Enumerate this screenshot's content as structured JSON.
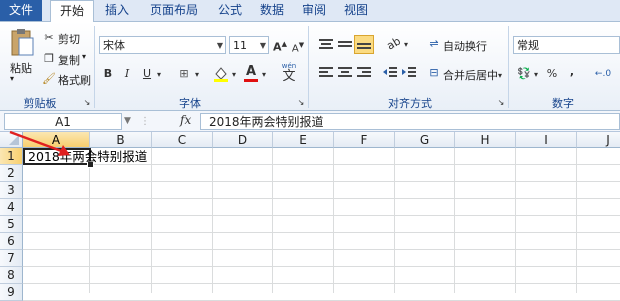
{
  "tabs": [
    {
      "label": "文件"
    },
    {
      "label": "开始"
    },
    {
      "label": "插入"
    },
    {
      "label": "页面布局"
    },
    {
      "label": "公式"
    },
    {
      "label": "数据"
    },
    {
      "label": "审阅"
    },
    {
      "label": "视图"
    }
  ],
  "clipboard": {
    "paste": "粘贴",
    "cut": "剪切",
    "copy": "复制",
    "format_painter": "格式刷",
    "group": "剪贴板"
  },
  "font": {
    "name": "宋体",
    "size": "11",
    "bold": "B",
    "italic": "I",
    "underline": "U",
    "font_color_glyph": "A",
    "phonetic_glyph": "wén",
    "group": "字体"
  },
  "alignment": {
    "wrap": "自动换行",
    "merge": "合并后居中",
    "group": "对齐方式"
  },
  "number": {
    "format": "常规",
    "percent": "%",
    "comma": ",",
    "group": "数字"
  },
  "formula_bar": {
    "name_box": "A1",
    "fx": "fx",
    "content": "2018年两会特别报道"
  },
  "columns": [
    "A",
    "B",
    "C",
    "D",
    "E",
    "F",
    "G",
    "H",
    "I",
    "J"
  ],
  "rows": [
    "1",
    "2",
    "3",
    "4",
    "5",
    "6",
    "7",
    "8",
    "9"
  ],
  "cell_a1": "2018年两会特别报道",
  "colors": {
    "accent": "#2a5fa8",
    "arrow": "#e02020",
    "selected_header": "#f8cf6e"
  }
}
